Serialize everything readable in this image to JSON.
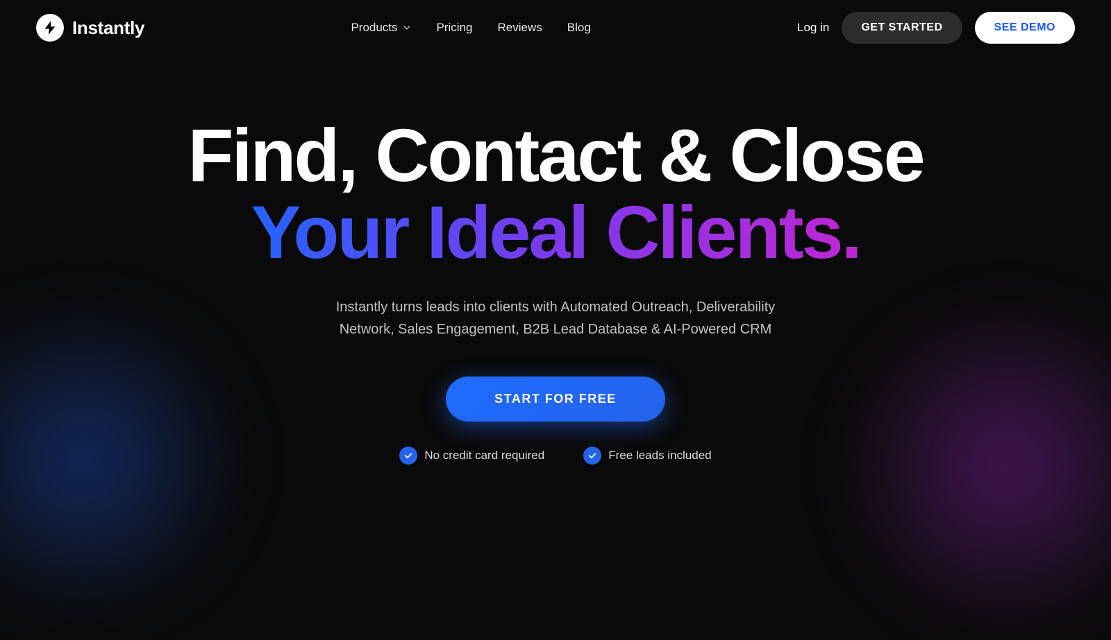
{
  "brand": {
    "name": "Instantly",
    "logo_alt": "Instantly logo"
  },
  "nav": {
    "products_label": "Products",
    "pricing_label": "Pricing",
    "reviews_label": "Reviews",
    "blog_label": "Blog",
    "login_label": "Log in",
    "get_started_label": "GET STARTED",
    "see_demo_label": "SEE DEMO"
  },
  "hero": {
    "heading_line1": "Find, Contact & Close",
    "heading_line2": "Your Ideal Clients.",
    "subheading": "Instantly turns leads into clients with Automated Outreach, Deliverability Network, Sales Engagement, B2B Lead Database & AI-Powered CRM",
    "cta_label": "START FOR FREE",
    "badge1": "No credit card required",
    "badge2": "Free leads included"
  },
  "colors": {
    "accent_blue": "#2563eb",
    "accent_purple": "#7c3aed",
    "accent_pink": "#c026d3"
  }
}
